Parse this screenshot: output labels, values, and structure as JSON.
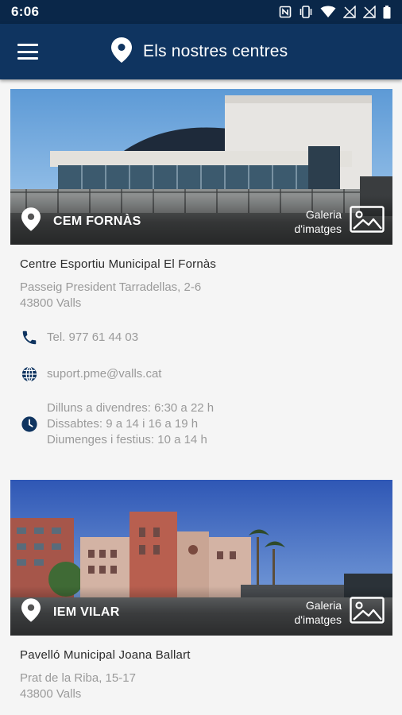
{
  "status_bar": {
    "time": "6:06"
  },
  "app_bar": {
    "title": "Els nostres centres"
  },
  "colors": {
    "status_bar": "#0a2749",
    "app_bar": "#0f3460",
    "icon": "#0f3460",
    "background": "#f5f5f5"
  },
  "centers": [
    {
      "short_name": "CEM FORNÀS",
      "gallery_line1": "Galeria",
      "gallery_line2": "d'imatges",
      "full_name": "Centre Esportiu Municipal El Fornàs",
      "address_line1": "Passeig President Tarradellas, 2-6",
      "address_line2": "43800 Valls",
      "phone": "Tel. 977 61 44 03",
      "email": "suport.pme@valls.cat",
      "hours": [
        "Dilluns a divendres: 6:30 a 22 h",
        "Dissabtes: 9 a 14 i 16 a 19 h",
        "Diumenges i festius: 10 a 14 h"
      ],
      "building_sign": "Centre Esportiu Municipal El Fornàs"
    },
    {
      "short_name": "IEM VILAR",
      "gallery_line1": "Galeria",
      "gallery_line2": "d'imatges",
      "full_name": "Pavelló Municipal Joana Ballart",
      "address_line1": "Prat de la Riba, 15-17",
      "address_line2": "43800 Valls"
    }
  ],
  "icons": {
    "menu": "hamburger-menu-icon",
    "title": "location-pin-icon",
    "phone": "phone-icon",
    "web": "globe-icon",
    "hours": "clock-icon",
    "gallery": "image-icon"
  }
}
